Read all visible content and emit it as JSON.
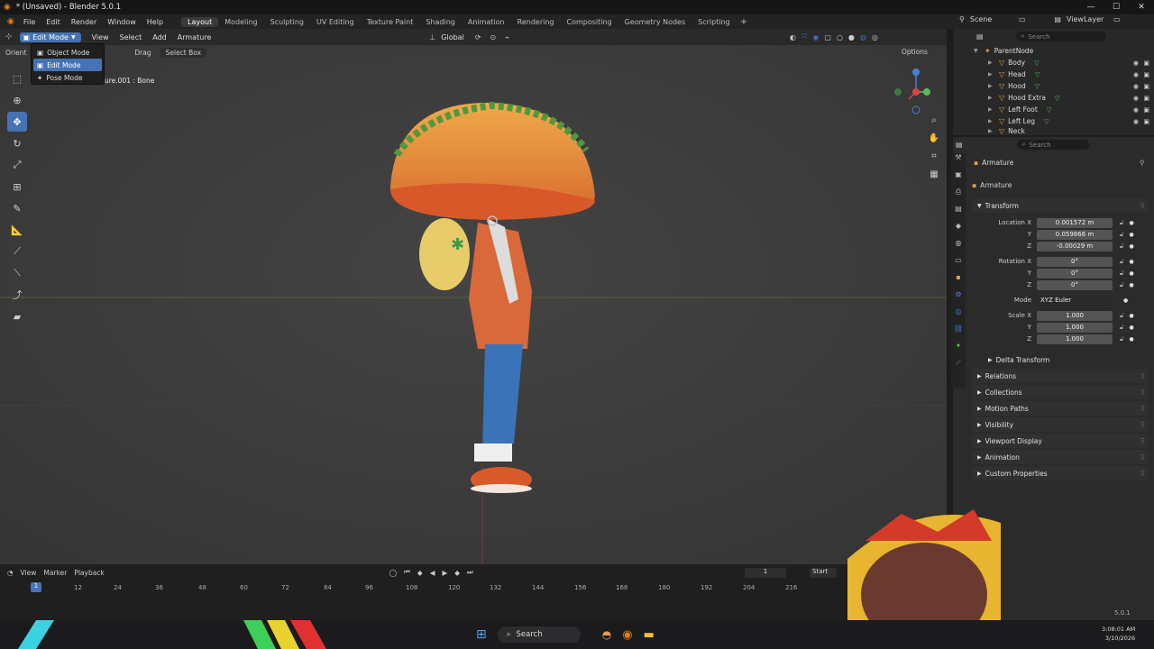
{
  "window": {
    "title": "* (Unsaved) - Blender 5.0.1",
    "controls": [
      "—",
      "☐",
      "✕"
    ]
  },
  "menu": {
    "items": [
      "File",
      "Edit",
      "Render",
      "Window",
      "Help"
    ]
  },
  "workspaces": [
    "Layout",
    "Modeling",
    "Sculpting",
    "UV Editing",
    "Texture Paint",
    "Shading",
    "Animation",
    "Rendering",
    "Compositing",
    "Geometry Nodes",
    "Scripting"
  ],
  "active_workspace": "Layout",
  "scene": {
    "name": "Scene",
    "view_layer": "ViewLayer"
  },
  "viewport_header": {
    "mode": "Edit Mode",
    "menus": [
      "View",
      "Select",
      "Add",
      "Armature"
    ],
    "transform_orientation": "Global",
    "options": "Options"
  },
  "viewport_sub": {
    "orient": "Orient",
    "drag": "Drag",
    "select_box": "Select Box"
  },
  "mode_menu": {
    "items": [
      "Object Mode",
      "Edit Mode",
      "Pose Mode"
    ],
    "active": 1
  },
  "object_label": "ure.001 : Bone",
  "timeline": {
    "menus": [
      "View",
      "Marker",
      "Playback"
    ],
    "current_frame": "1",
    "start_label": "Start",
    "ticks": [
      "1",
      "12",
      "24",
      "36",
      "48",
      "60",
      "72",
      "84",
      "96",
      "108",
      "120",
      "132",
      "144",
      "156",
      "168",
      "180",
      "192",
      "204",
      "216"
    ]
  },
  "outliner": {
    "search_placeholder": "Search",
    "items": [
      {
        "name": "ParentNode",
        "level": 0
      },
      {
        "name": "Body",
        "level": 1
      },
      {
        "name": "Head",
        "level": 1
      },
      {
        "name": "Hood",
        "level": 1
      },
      {
        "name": "Hood Extra",
        "level": 1
      },
      {
        "name": "Left Foot",
        "level": 1
      },
      {
        "name": "Left Leg",
        "level": 1
      },
      {
        "name": "Neck",
        "level": 1
      }
    ]
  },
  "properties": {
    "search_placeholder": "Search",
    "breadcrumb": "Armature",
    "data_name": "Armature",
    "transform_label": "Transform",
    "location_label": "Location X",
    "location": [
      "0.001572 m",
      "0.059866 m",
      "-0.00029 m"
    ],
    "rotation_label": "Rotation X",
    "rotation": [
      "0°",
      "0°",
      "0°"
    ],
    "mode_label": "Mode",
    "rotation_mode": "XYZ Euler",
    "scale_label": "Scale X",
    "scale": [
      "1.000",
      "1.000",
      "1.000"
    ],
    "axis_y": "Y",
    "axis_z": "Z",
    "delta_transform": "Delta Transform",
    "panels": [
      "Relations",
      "Collections",
      "Motion Paths",
      "Visibility",
      "Viewport Display",
      "Animation",
      "Custom Properties"
    ]
  },
  "taskbar": {
    "search": "Search",
    "time": "3:08:01 AM",
    "date": "3/10/2026"
  },
  "version": "5.0.1",
  "colors": {
    "accent": "#4772b3",
    "bone": "#e8a045",
    "vgroup": "#5cb85c"
  }
}
